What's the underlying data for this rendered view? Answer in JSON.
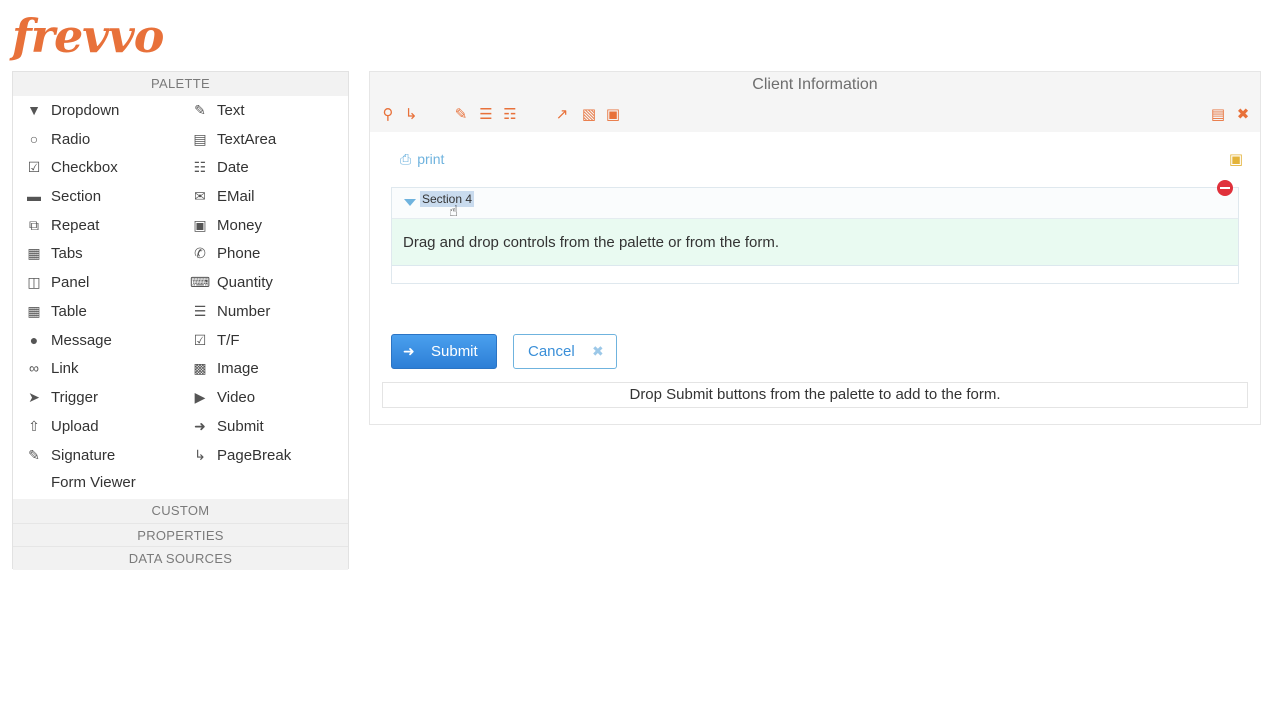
{
  "logo": {
    "text": "frevvo",
    "color": "#e8713a"
  },
  "palette": {
    "header": "PALETTE",
    "left_items": [
      {
        "label": "Dropdown",
        "icon": "dropdown-icon"
      },
      {
        "label": "Radio",
        "icon": "radio-icon"
      },
      {
        "label": "Checkbox",
        "icon": "checkbox-icon"
      },
      {
        "label": "Section",
        "icon": "folder-icon"
      },
      {
        "label": "Repeat",
        "icon": "repeat-icon"
      },
      {
        "label": "Tabs",
        "icon": "tabs-icon"
      },
      {
        "label": "Panel",
        "icon": "panel-icon"
      },
      {
        "label": "Table",
        "icon": "table-icon"
      },
      {
        "label": "Message",
        "icon": "message-icon"
      },
      {
        "label": "Link",
        "icon": "link-icon"
      },
      {
        "label": "Trigger",
        "icon": "trigger-icon"
      },
      {
        "label": "Upload",
        "icon": "upload-icon"
      },
      {
        "label": "Signature",
        "icon": "pencil-icon"
      },
      {
        "label": "Form Viewer",
        "icon": "book-icon"
      }
    ],
    "right_items": [
      {
        "label": "Text",
        "icon": "edit-icon"
      },
      {
        "label": "TextArea",
        "icon": "textarea-icon"
      },
      {
        "label": "Date",
        "icon": "calendar-icon"
      },
      {
        "label": "EMail",
        "icon": "envelope-icon"
      },
      {
        "label": "Money",
        "icon": "money-icon"
      },
      {
        "label": "Phone",
        "icon": "phone-icon"
      },
      {
        "label": "Quantity",
        "icon": "keyboard-icon"
      },
      {
        "label": "Number",
        "icon": "list-ol-icon"
      },
      {
        "label": "T/F",
        "icon": "check-square-icon"
      },
      {
        "label": "Image",
        "icon": "image-icon"
      },
      {
        "label": "Video",
        "icon": "video-icon"
      },
      {
        "label": "Submit",
        "icon": "sign-in-icon"
      },
      {
        "label": "PageBreak",
        "icon": "level-down-icon"
      }
    ],
    "custom_header": "CUSTOM",
    "properties_header": "PROPERTIES",
    "data_sources_header": "DATA SOURCES"
  },
  "form": {
    "title": "Client Information",
    "print_label": "print",
    "section": {
      "title": "Section 4",
      "drop_hint": "Drag and drop controls from the palette or from the form."
    },
    "submit_label": "Submit",
    "cancel_label": "Cancel",
    "submit_drop_hint": "Drop Submit buttons from the palette to add to the form."
  },
  "colors": {
    "accent_orange": "#e8713a",
    "primary_blue": "#3a8fe0",
    "section_green": "#e9faf1",
    "remove_red": "#e0313b"
  }
}
